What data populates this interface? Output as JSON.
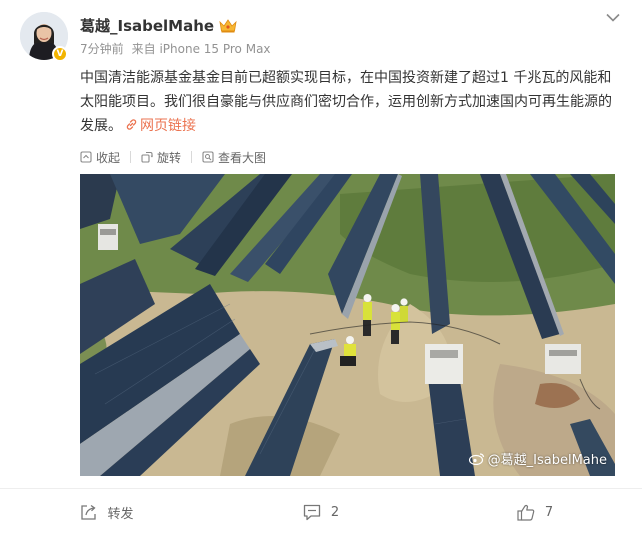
{
  "post": {
    "username": "葛越_IsabelMahe",
    "time": "7分钟前",
    "source": "来自 iPhone 15 Pro Max",
    "text": "中国清洁能源基金基金目前已超额实现目标，在中国投资新建了超过1 千兆瓦的风能和太阳能项目。我们很自豪能与供应商们密切合作，运用创新方式加速国内可再生能源的发展。",
    "link_label": "网页链接",
    "verified_badge": "V"
  },
  "media_toolbar": {
    "collapse": "收起",
    "rotate": "旋转",
    "view_large": "查看大图"
  },
  "image": {
    "watermark": "@葛越_IsabelMahe",
    "subject": "solar-farm-aerial-photo"
  },
  "footer": {
    "repost": "转发",
    "comments": "2",
    "likes": "7"
  },
  "colors": {
    "link": "#eb7350",
    "meta": "#939393",
    "text": "#333333",
    "badge": "#f2b400"
  }
}
